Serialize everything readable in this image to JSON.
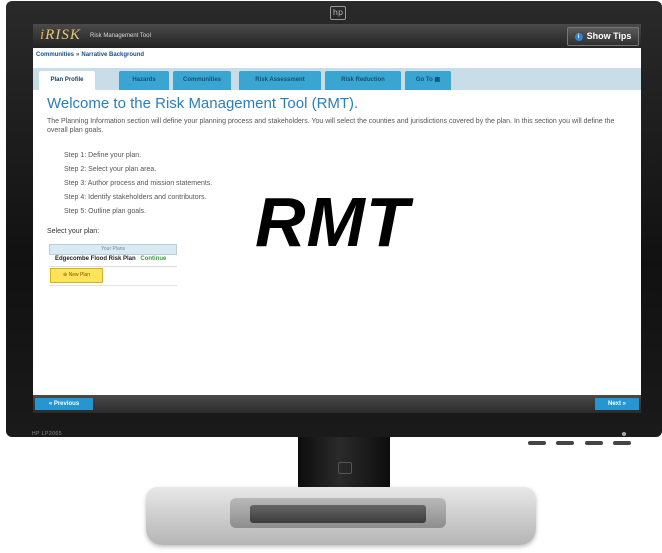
{
  "monitor": {
    "brand_logo": "hp",
    "model_label": "HP LP2065"
  },
  "app": {
    "brand_prefix": "i",
    "brand_name": "RISK",
    "subtitle": "Risk Management Tool",
    "show_tips_label": "Show Tips",
    "accent_color": "#2a7ec0"
  },
  "breadcrumb": {
    "items": [
      "Communities",
      "Narrative Background"
    ],
    "separator": "»"
  },
  "tabs": [
    {
      "label": "Plan Profile",
      "active": true
    },
    {
      "label": "Hazards",
      "active": false
    },
    {
      "label": "Communities",
      "active": false
    },
    {
      "label": "Risk Assessment",
      "active": false
    },
    {
      "label": "Risk Reduction",
      "active": false
    },
    {
      "label": "Go To",
      "active": false
    }
  ],
  "main": {
    "title": "Welcome to the Risk Management Tool (RMT).",
    "intro": "The Planning Information section will define your planning process and stakeholders. You will select the counties and jurisdictions covered by the plan. In this section you will define the overall plan goals.",
    "steps": [
      "Step 1: Define your plan.",
      "Step 2: Select your plan area.",
      "Step 3: Author process and mission statements.",
      "Step 4: Identify stakeholders and contributors.",
      "Step 5: Outline plan goals."
    ],
    "select_label": "Select your plan:",
    "plans_header": "Your Plans",
    "plans": [
      {
        "name": "Edgecombe Flood Risk Plan",
        "action": "Continue"
      }
    ],
    "new_plan_label": "New Plan"
  },
  "footer": {
    "previous_label": "« Previous",
    "next_label": "Next »"
  },
  "overlay": {
    "text": "RMT"
  }
}
